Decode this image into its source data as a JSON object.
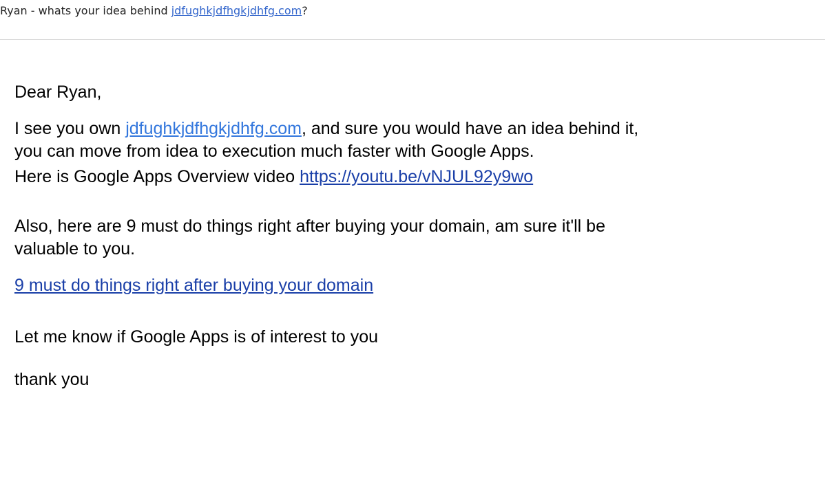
{
  "subject": {
    "prefix": "Ryan - whats your idea behind ",
    "link": "jdfughkjdfhgkjdhfg.com",
    "suffix": "?"
  },
  "message": {
    "greeting": "Dear Ryan,",
    "intro_prefix": "I see you own ",
    "intro_link": "jdfughkjdfhgkjdhfg.com",
    "intro_suffix": ", and sure you would have an idea behind it,",
    "intro_line2": "you can move from idea to execution much faster with Google Apps.",
    "video_text": "Here is Google Apps Overview video ",
    "video_link": "https://youtu.be/vNJUL92y9wo",
    "also_line1": "Also, here are 9 must do things right after buying your domain, am sure it'll be",
    "also_line2": "valuable to you.",
    "things_link": "9 must do things right after buying your domain",
    "interest": "Let me know if Google Apps is of interest to you",
    "signoff": "thank you"
  },
  "colors": {
    "link_bright": "#3377dd",
    "link_dark": "#1a3fa8",
    "divider": "#dadada"
  }
}
